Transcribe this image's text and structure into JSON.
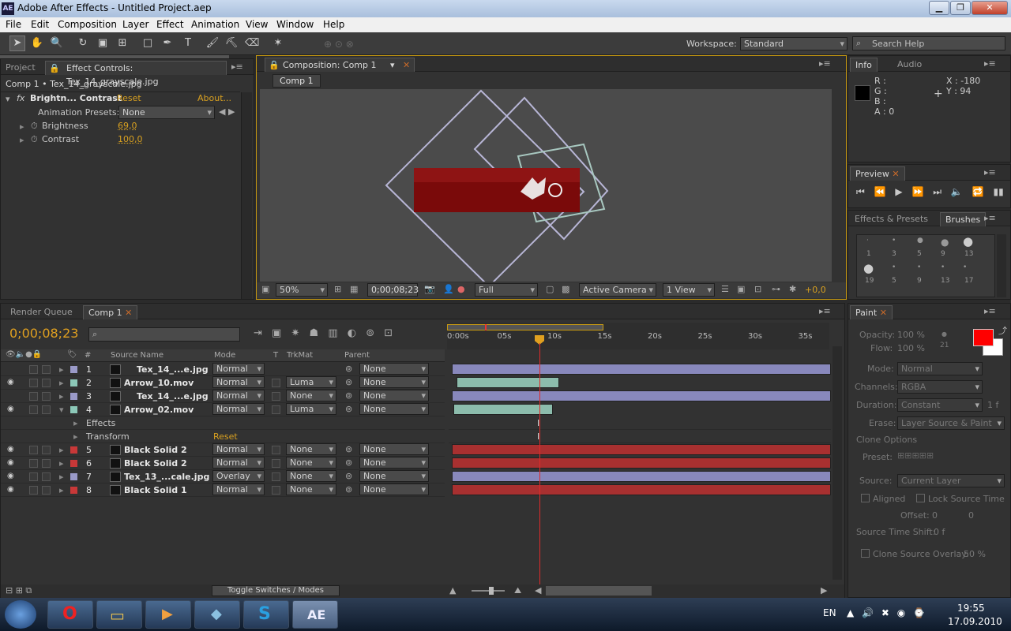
{
  "window": {
    "title": "Adobe After Effects - Untitled Project.aep",
    "icon": "AE"
  },
  "menu": [
    "File",
    "Edit",
    "Composition",
    "Layer",
    "Effect",
    "Animation",
    "View",
    "Window",
    "Help"
  ],
  "toolbar": {
    "workspace_label": "Workspace:",
    "workspace_value": "Standard",
    "search_placeholder": "Search Help"
  },
  "project_panel": {
    "tab_project": "Project",
    "tab_effect": "Effect Controls: Tex_14_grayscale.jpg",
    "path": "Comp 1 • Tex_14_grayscale.jpg",
    "effect_name": "Brightn... Contrast",
    "reset": "Reset",
    "about": "About...",
    "presets_label": "Animation Presets:",
    "presets_value": "None",
    "props": [
      {
        "name": "Brightness",
        "value": "69,0"
      },
      {
        "name": "Contrast",
        "value": "100,0"
      }
    ]
  },
  "comp_panel": {
    "tab": "Composition: Comp 1",
    "crumb": "Comp 1",
    "zoom": "50%",
    "timecode": "0;00;08;23",
    "resolution": "Full",
    "camera": "Active Camera",
    "views": "1 View",
    "exposure": "+0,0"
  },
  "info_panel": {
    "tab_info": "Info",
    "tab_audio": "Audio",
    "r": "R :",
    "g": "G :",
    "b": "B :",
    "a": "A : 0",
    "x": "X : -180",
    "y": "Y : 94"
  },
  "preview_panel": {
    "tab": "Preview"
  },
  "brushes_panel": {
    "tab_effects": "Effects & Presets",
    "tab_brushes": "Brushes",
    "sizes_row1": [
      "1",
      "3",
      "5",
      "9",
      "13"
    ],
    "sizes_row2": [
      "19",
      "5",
      "9",
      "13",
      "17"
    ]
  },
  "timeline": {
    "tab_render": "Render Queue",
    "tab_comp": "Comp 1",
    "timecode": "0;00;08;23",
    "col_source": "Source Name",
    "col_mode": "Mode",
    "col_t": "T",
    "col_trkmat": "TrkMat",
    "col_parent": "Parent",
    "ruler": [
      "0:00s",
      "05s",
      "10s",
      "15s",
      "20s",
      "25s",
      "30s",
      "35s"
    ],
    "toggle": "Toggle Switches / Modes",
    "layers": [
      {
        "num": "1",
        "name": "Tex_14_...e.jpg",
        "mode": "Normal",
        "trkmat": "",
        "parent": "None",
        "color": "#9a9ac8"
      },
      {
        "num": "2",
        "name": "Arrow_10.mov",
        "mode": "Normal",
        "trkmat": "Luma",
        "parent": "None",
        "color": "#8cc8b8"
      },
      {
        "num": "3",
        "name": "Tex_14_...e.jpg",
        "mode": "Normal",
        "trkmat": "None",
        "parent": "None",
        "color": "#9a9ac8"
      },
      {
        "num": "4",
        "name": "Arrow_02.mov",
        "mode": "Normal",
        "trkmat": "Luma",
        "parent": "None",
        "color": "#8cc8b8"
      },
      {
        "num": "5",
        "name": "Black Solid 2",
        "mode": "Normal",
        "trkmat": "None",
        "parent": "None",
        "color": "#c83838"
      },
      {
        "num": "6",
        "name": "Black Solid 2",
        "mode": "Normal",
        "trkmat": "None",
        "parent": "None",
        "color": "#c83838"
      },
      {
        "num": "7",
        "name": "Tex_13_...cale.jpg",
        "mode": "Overlay",
        "trkmat": "None",
        "parent": "None",
        "color": "#9a9ac8"
      },
      {
        "num": "8",
        "name": "Black Solid 1",
        "mode": "Normal",
        "trkmat": "None",
        "parent": "None",
        "color": "#c83838"
      }
    ],
    "sub_effects": "Effects",
    "sub_transform": "Transform",
    "sub_reset": "Reset"
  },
  "paint_panel": {
    "tab": "Paint",
    "opacity_label": "Opacity:",
    "opacity": "100 %",
    "flow_label": "Flow:",
    "flow": "100 %",
    "brush_size": "21",
    "mode_label": "Mode:",
    "mode": "Normal",
    "channels_label": "Channels:",
    "channels": "RGBA",
    "duration_label": "Duration:",
    "duration": "Constant",
    "duration_f": "1 f",
    "erase_label": "Erase:",
    "erase": "Layer Source & Paint",
    "clone_options": "Clone Options",
    "preset_label": "Preset:",
    "source_label": "Source:",
    "source": "Current Layer",
    "aligned": "Aligned",
    "lock_source": "Lock Source Time",
    "offset_label": "Offset:",
    "offset_x": "0",
    "offset_y": "0",
    "shift_label": "Source Time Shift:",
    "shift": "0 f",
    "overlay_label": "Clone Source Overlay:",
    "overlay": "50 %"
  },
  "taskbar": {
    "lang": "EN",
    "time": "19:55",
    "date": "17.09.2010"
  }
}
